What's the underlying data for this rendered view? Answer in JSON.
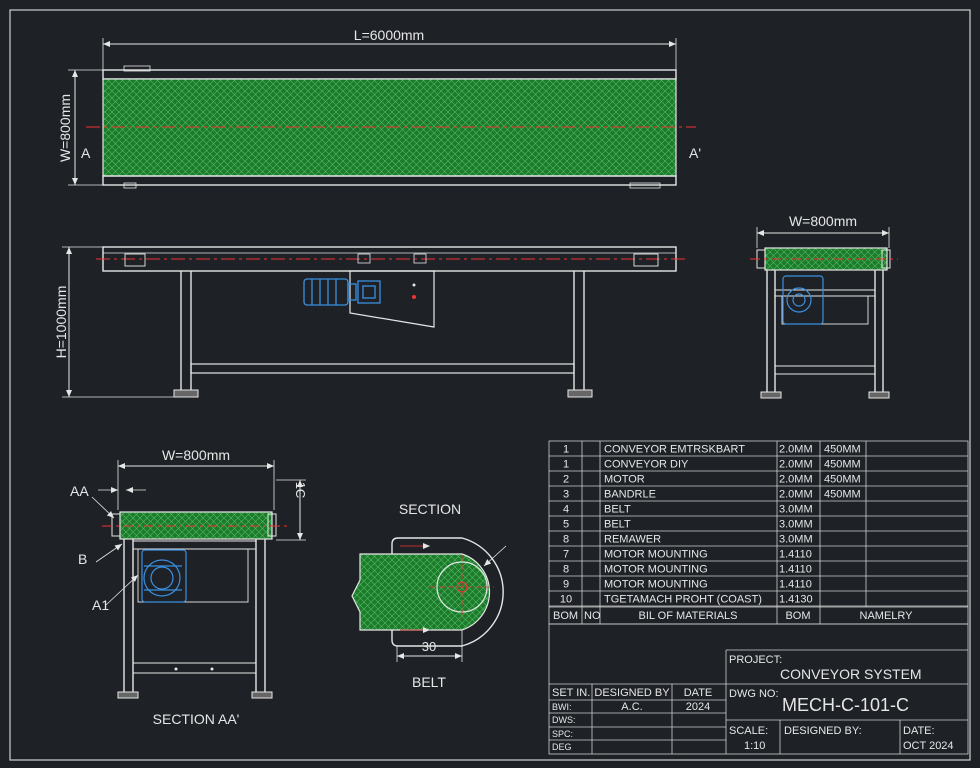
{
  "top_view": {
    "length_label": "L=6000mm",
    "width_label": "W=800mm",
    "section_left": "A",
    "section_right": "A'"
  },
  "side_view": {
    "height_label": "H=1000mm"
  },
  "end_view": {
    "width_label": "W=800mm"
  },
  "section_aa": {
    "width_label": "W=800mm",
    "callout_aa": "AA",
    "callout_b": "B",
    "callout_a1": "A1",
    "height_callout": "1C",
    "title": "SECTION AA'"
  },
  "belt_detail": {
    "section_label": "SECTION",
    "dimension": "30",
    "title": "BELT"
  },
  "bom": {
    "rows": [
      {
        "item": "1",
        "name": "CONVEYOR EMTRSKBART",
        "size": "2.0MM",
        "qty": "450MM"
      },
      {
        "item": "1",
        "name": "CONVEYOR DIY",
        "size": "2.0MM",
        "qty": "450MM"
      },
      {
        "item": "2",
        "name": "MOTOR",
        "size": "2.0MM",
        "qty": "450MM"
      },
      {
        "item": "3",
        "name": "BANDRLE",
        "size": "2.0MM",
        "qty": "450MM"
      },
      {
        "item": "4",
        "name": "BELT",
        "size": "3.0MM",
        "qty": ""
      },
      {
        "item": "5",
        "name": "BELT",
        "size": "3.0MM",
        "qty": ""
      },
      {
        "item": "8",
        "name": "REMAWER",
        "size": "3.0MM",
        "qty": ""
      },
      {
        "item": "7",
        "name": "MOTOR MOUNTING",
        "size": "1.4110",
        "qty": ""
      },
      {
        "item": "8",
        "name": "MOTOR MOUNTING",
        "size": "1.4110",
        "qty": ""
      },
      {
        "item": "9",
        "name": "MOTOR MOUNTING",
        "size": "1.4110",
        "qty": ""
      },
      {
        "item": "10",
        "name": "TGETAMACH PROHT (COAST)",
        "size": "1.4130",
        "qty": ""
      }
    ],
    "header": {
      "bom": "BOM",
      "no": "NO",
      "materials": "BIL OF MATERIALS",
      "bom2": "BOM",
      "name": "NAMELRY"
    }
  },
  "title_block": {
    "project_label": "PROJECT:",
    "project_value": "CONVEYOR SYSTEM",
    "dwg_label": "DWG NO:",
    "dwg_value": "MECH-C-101-C",
    "scale_label": "SCALE:",
    "scale_value": "1:10",
    "designed_label": "DESIGNED BY:",
    "date_label": "DATE:",
    "date_value": "OCT 2024",
    "rev_headers": {
      "set": "SET IN.",
      "designed": "DESIGNED BY",
      "date": "DATE"
    },
    "rev_rows": [
      {
        "label": "BWI:",
        "designed": "A.C.",
        "date": "2024"
      },
      {
        "label": "DWS:",
        "designed": "",
        "date": ""
      },
      {
        "label": "SPC:",
        "designed": "",
        "date": ""
      },
      {
        "label": "DEG",
        "designed": "",
        "date": ""
      }
    ]
  },
  "colors": {
    "background": "#1e2227",
    "line": "#e6e6e6",
    "belt": "#1e7a2e",
    "center_line": "#e33",
    "motor": "#3a8fe0"
  }
}
